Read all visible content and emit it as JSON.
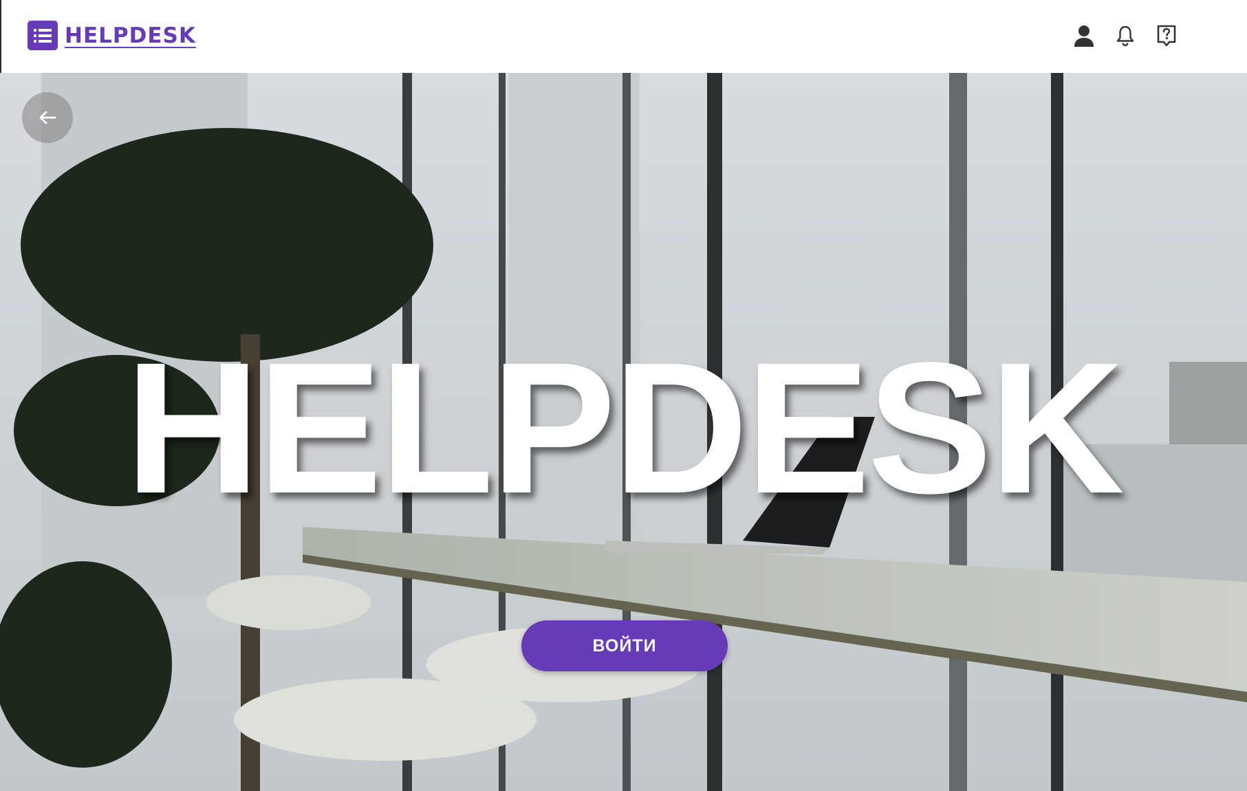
{
  "header": {
    "brand_name": "HELPDESK",
    "brand_icon": "list-icon",
    "actions": [
      {
        "name": "account",
        "icon": "person-icon"
      },
      {
        "name": "notifications",
        "icon": "bell-icon"
      },
      {
        "name": "help",
        "icon": "help-box-icon"
      }
    ]
  },
  "hero": {
    "title": "HELPDESK",
    "login_label": "ВОЙТИ",
    "back_icon": "arrow-left-icon"
  },
  "colors": {
    "brand": "#673ab7",
    "hero_text": "#ffffff",
    "icon": "#333333"
  }
}
